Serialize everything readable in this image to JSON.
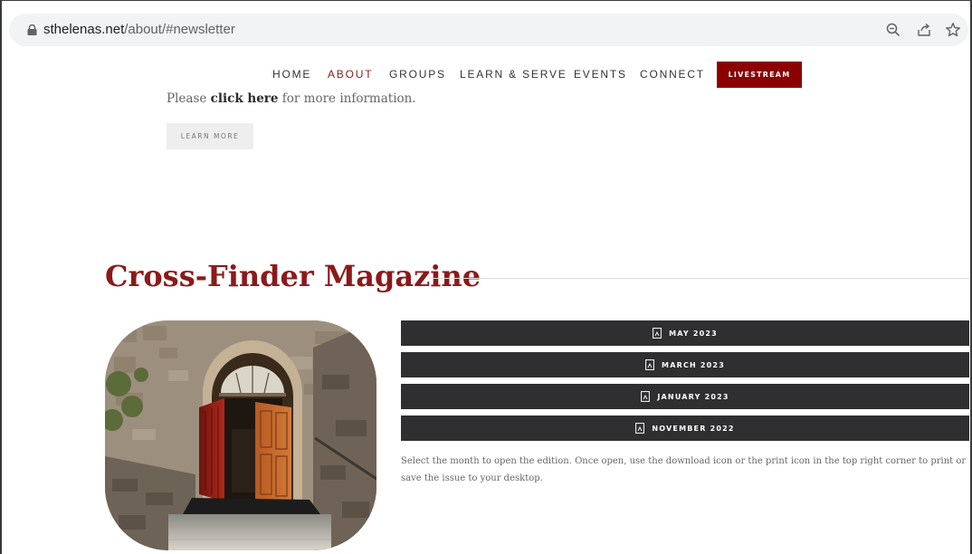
{
  "browser": {
    "url_host": "sthelenas.net",
    "url_path": "/about/#newsletter",
    "icons": [
      "lock-icon",
      "zoom-icon",
      "share-icon",
      "bookmark-star-icon"
    ]
  },
  "nav": {
    "items": [
      {
        "label": "HOME"
      },
      {
        "label": "ABOUT",
        "active": true
      },
      {
        "label": "GROUPS"
      },
      {
        "label": "LEARN & SERVE"
      },
      {
        "label": "EVENTS"
      },
      {
        "label": "CONNECT"
      }
    ],
    "livestream_label": "LIVESTREAM"
  },
  "info": {
    "prefix": "Please ",
    "link": "click here",
    "suffix": " for more information.",
    "learn_more_label": "LEARN MORE"
  },
  "magazine": {
    "title": "Cross-Finder Magazine",
    "editions": [
      {
        "label": "MAY 2023"
      },
      {
        "label": "MARCH 2023"
      },
      {
        "label": "JANUARY 2023"
      },
      {
        "label": "NOVEMBER 2022"
      }
    ],
    "help_text": "Select the month to open the edition. Once open, use the download icon or the print icon in the top right corner to print or save the issue to your desktop."
  },
  "colors": {
    "accent": "#8b1a1a",
    "livestream_bg": "#8b0000",
    "edition_bg": "#2f2f31"
  }
}
